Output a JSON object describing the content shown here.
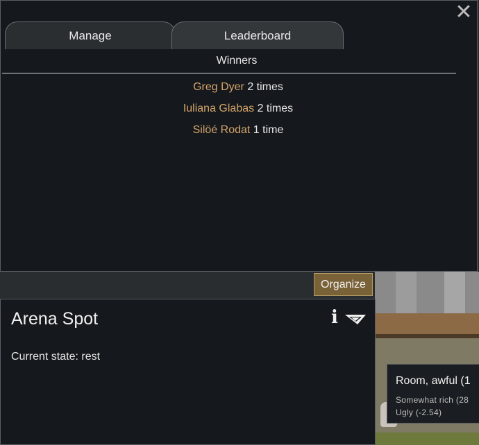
{
  "dialog": {
    "tabs": [
      {
        "label": "Manage"
      },
      {
        "label": "Leaderboard"
      }
    ],
    "section_title": "Winners",
    "winners": [
      {
        "name": "Greg Dyer",
        "count": "2 times"
      },
      {
        "name": "Iuliana Glabas",
        "count": "2 times"
      },
      {
        "name": "Silöé Rodat",
        "count": "1 time"
      }
    ]
  },
  "organize_button": "Organize",
  "inspect": {
    "title": "Arena Spot",
    "state": "Current state: rest",
    "info_icon_glyph": "i"
  },
  "room_tooltip": {
    "title": "Room, awful (1",
    "lines": [
      "Somewhat rich (28",
      "Ugly (-2.54)"
    ]
  },
  "colors": {
    "panel_bg": "#15191d",
    "winner_name": "#d6a46a",
    "button_bg": "#7a6238"
  },
  "icons": {
    "close": "close-icon",
    "info": "info-icon",
    "dropdown": "dropdown-triangle-icon"
  }
}
